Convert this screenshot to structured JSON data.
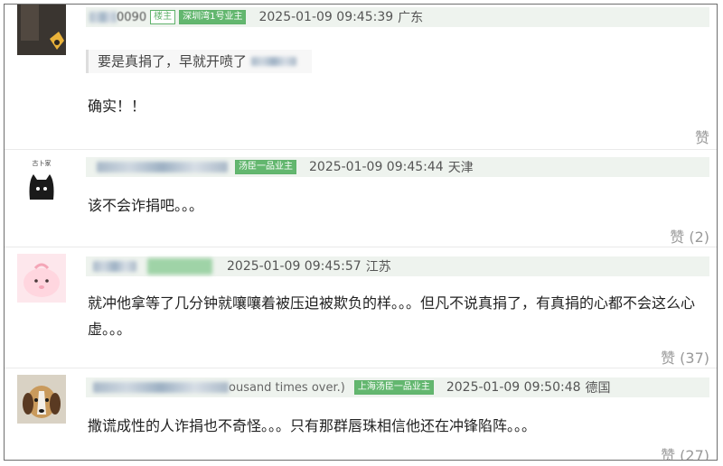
{
  "comments": [
    {
      "name_visible": "0090",
      "badges": [
        "楼主",
        "深圳湾1号业主"
      ],
      "time": "2025-01-09 09:45:39",
      "location": "广东",
      "quote": "要是真捐了，早就开喷了",
      "text": "确实！！",
      "like": "赞"
    },
    {
      "name_visible": "",
      "badges": [
        "汤臣一品业主"
      ],
      "time": "2025-01-09 09:45:44",
      "location": "天津",
      "avatar_text": "古卜家",
      "text": "该不会诈捐吧。。。",
      "like": "赞 (2)"
    },
    {
      "name_visible": "",
      "badges": [],
      "time": "2025-01-09 09:45:57",
      "location": "江苏",
      "text": "就冲他拿等了几分钟就嚷嚷着被压迫被欺负的样。。。但凡不说真捐了，有真捐的心都不会这么心虚。。。",
      "like": "赞 (37)"
    },
    {
      "name_visible": "ousand times over.)",
      "badges": [
        "上海汤臣一品业主"
      ],
      "time": "2025-01-09 09:50:48",
      "location": "德国",
      "text": "撒谎成性的人诈捐也不奇怪。。。只有那群唇珠相信他还在冲锋陷阵。。。",
      "like": "赞 (27)"
    }
  ],
  "colors": {
    "badge_green": "#63b76f",
    "meta_bg": "#eef3ee",
    "like_gray": "#999999"
  }
}
